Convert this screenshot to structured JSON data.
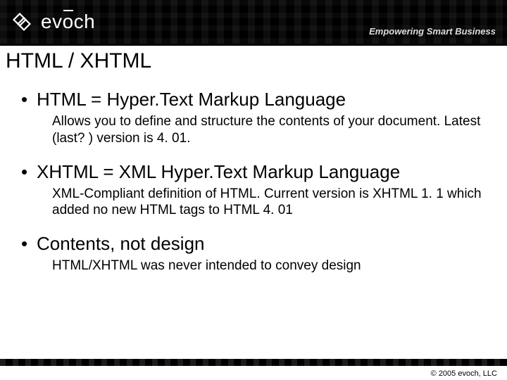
{
  "header": {
    "logo_text": "evoch",
    "tagline": "Empowering Smart Business"
  },
  "slide": {
    "title": "HTML / XHTML",
    "bullets": [
      {
        "heading": "HTML = Hyper.Text Markup Language",
        "description": "Allows you to define and structure the contents of your document.  Latest (last? ) version is 4. 01."
      },
      {
        "heading": "XHTML = XML Hyper.Text Markup Language",
        "description": "XML-Compliant definition of HTML.  Current version is XHTML 1. 1 which added no new HTML tags to HTML 4. 01"
      },
      {
        "heading": "Contents, not design",
        "description": "HTML/XHTML was never intended to convey design"
      }
    ]
  },
  "footer": {
    "copyright": "© 2005  evoch, LLC"
  }
}
